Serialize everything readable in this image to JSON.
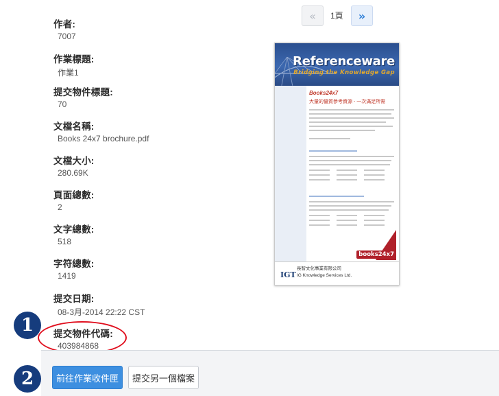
{
  "pager": {
    "prev_label": "«",
    "page_text": "1頁",
    "next_label": "»"
  },
  "metadata": {
    "author_label": "作者:",
    "author_value": "7007",
    "assignment_title_label": "作業標題:",
    "assignment_title_value": "作業1",
    "submission_title_label": "提交物件標題:",
    "submission_title_value": "70",
    "filename_label": "文檔名稱:",
    "filename_value": "Books 24x7 brochure.pdf",
    "filesize_label": "文檔大小:",
    "filesize_value": "280.69K",
    "page_count_label": "頁面總數:",
    "page_count_value": "2",
    "word_count_label": "文字總數:",
    "word_count_value": "518",
    "char_count_label": "字符總數:",
    "char_count_value": "1419",
    "submit_date_label": "提交日期:",
    "submit_date_value": "08-3月-2014 22:22 CST",
    "submission_id_label": "提交物件代碼:",
    "submission_id_value": "403984868"
  },
  "preview": {
    "title": "Referenceware",
    "subtitle": "Bridging the Knowledge Gap",
    "brand": "Books24x7",
    "headline": "大量的優質參考資源 - 一次滿足所需",
    "logo": "books24x7",
    "footer_logo": "IGT",
    "company_line1": "長智文化事業有限公司",
    "company_line2": "IG Knowledge Services Ltd."
  },
  "markers": {
    "one": "1",
    "two": "2"
  },
  "actions": {
    "go_inbox_label": "前往作業收件匣",
    "submit_another_label": "提交另一個檔案"
  },
  "colors": {
    "marker": "#163c7d",
    "highlight_ellipse": "#e00f1e",
    "primary_button": "#3d8fe0"
  }
}
